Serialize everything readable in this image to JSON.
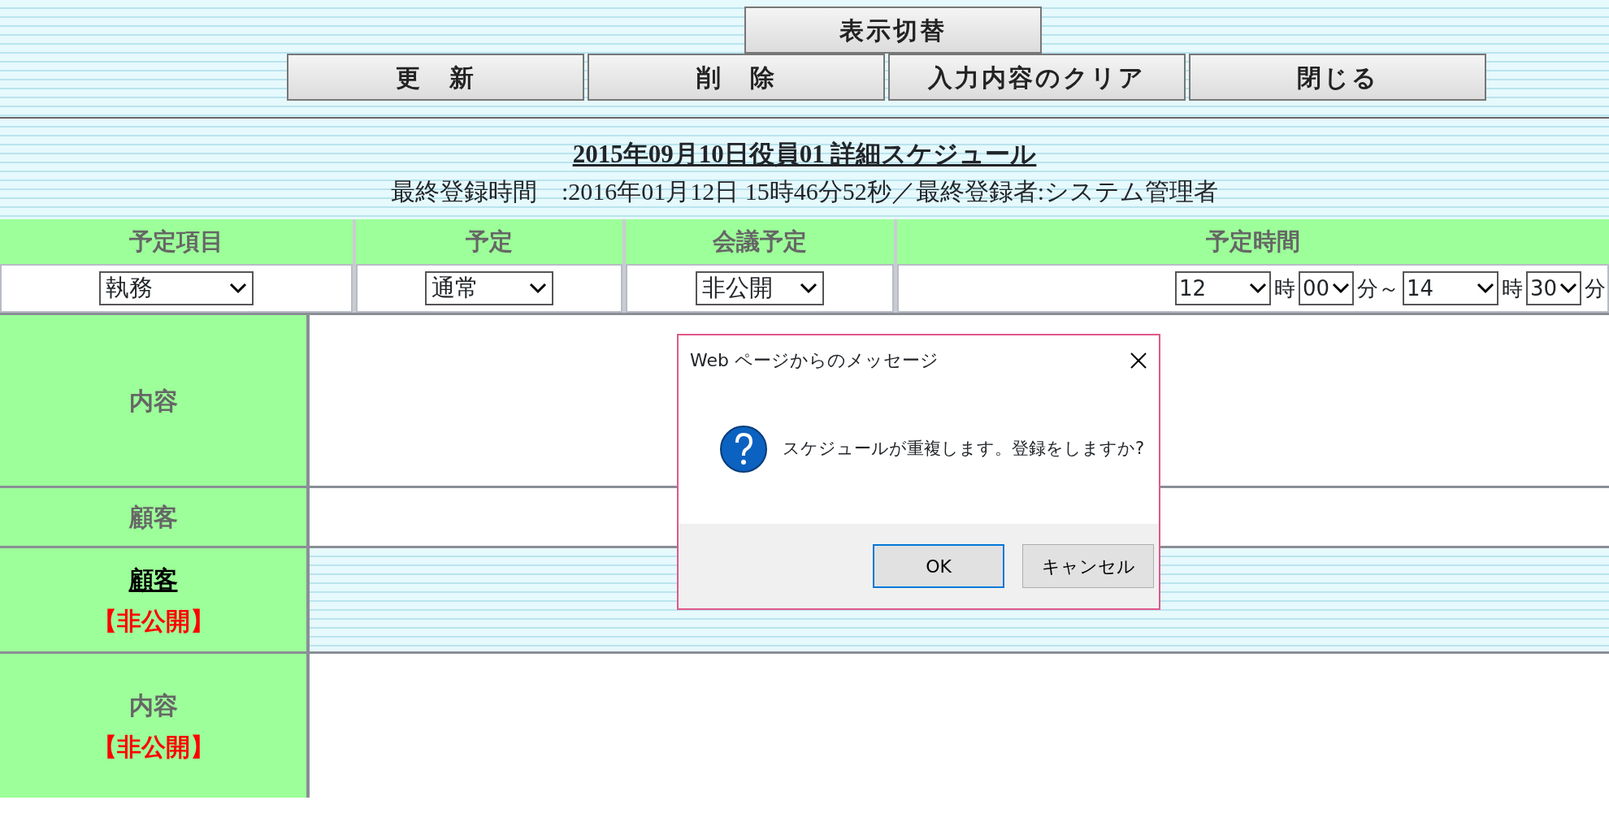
{
  "toolbar": {
    "top_buttons": [
      {
        "label": "表示切替"
      }
    ],
    "buttons": [
      {
        "label": "更　新"
      },
      {
        "label": "削　除"
      },
      {
        "label": "入力内容のクリア"
      },
      {
        "label": "閉じる"
      }
    ]
  },
  "header": {
    "title": "2015年09月10日役員01 詳細スケジュール",
    "info": "最終登録時間　:2016年01月12日 15時46分52秒／最終登録者:システム管理者"
  },
  "schedule_grid": {
    "columns": [
      "予定項目",
      "予定",
      "会議予定",
      "予定時間"
    ],
    "selects": [
      {
        "value": "執務"
      },
      {
        "value": "通常"
      },
      {
        "value": "非公開"
      }
    ],
    "time_parts": [
      {
        "kind": "select",
        "text": "12"
      },
      {
        "kind": "label",
        "text": "時"
      },
      {
        "kind": "select",
        "text": "00"
      },
      {
        "kind": "label",
        "text": "分～"
      },
      {
        "kind": "select",
        "text": "14"
      },
      {
        "kind": "label",
        "text": "時"
      },
      {
        "kind": "select",
        "text": "30"
      },
      {
        "kind": "label",
        "text": "分"
      }
    ]
  },
  "form_rows": [
    {
      "label": "内容",
      "link": false,
      "disabled": false
    },
    {
      "label": "顧客",
      "link": false,
      "disabled": false
    },
    {
      "label": "顧客",
      "link": true,
      "note": "【非公開】",
      "disabled": true
    },
    {
      "label": "内容",
      "link": false,
      "note": "【非公開】",
      "disabled": false
    }
  ],
  "dialog": {
    "title": "Web ページからのメッセージ",
    "message": "スケジュールが重複します。登録をしますか?",
    "buttons": [
      {
        "label": "OK",
        "default": true
      },
      {
        "label": "キャンセル",
        "default": false
      }
    ]
  }
}
